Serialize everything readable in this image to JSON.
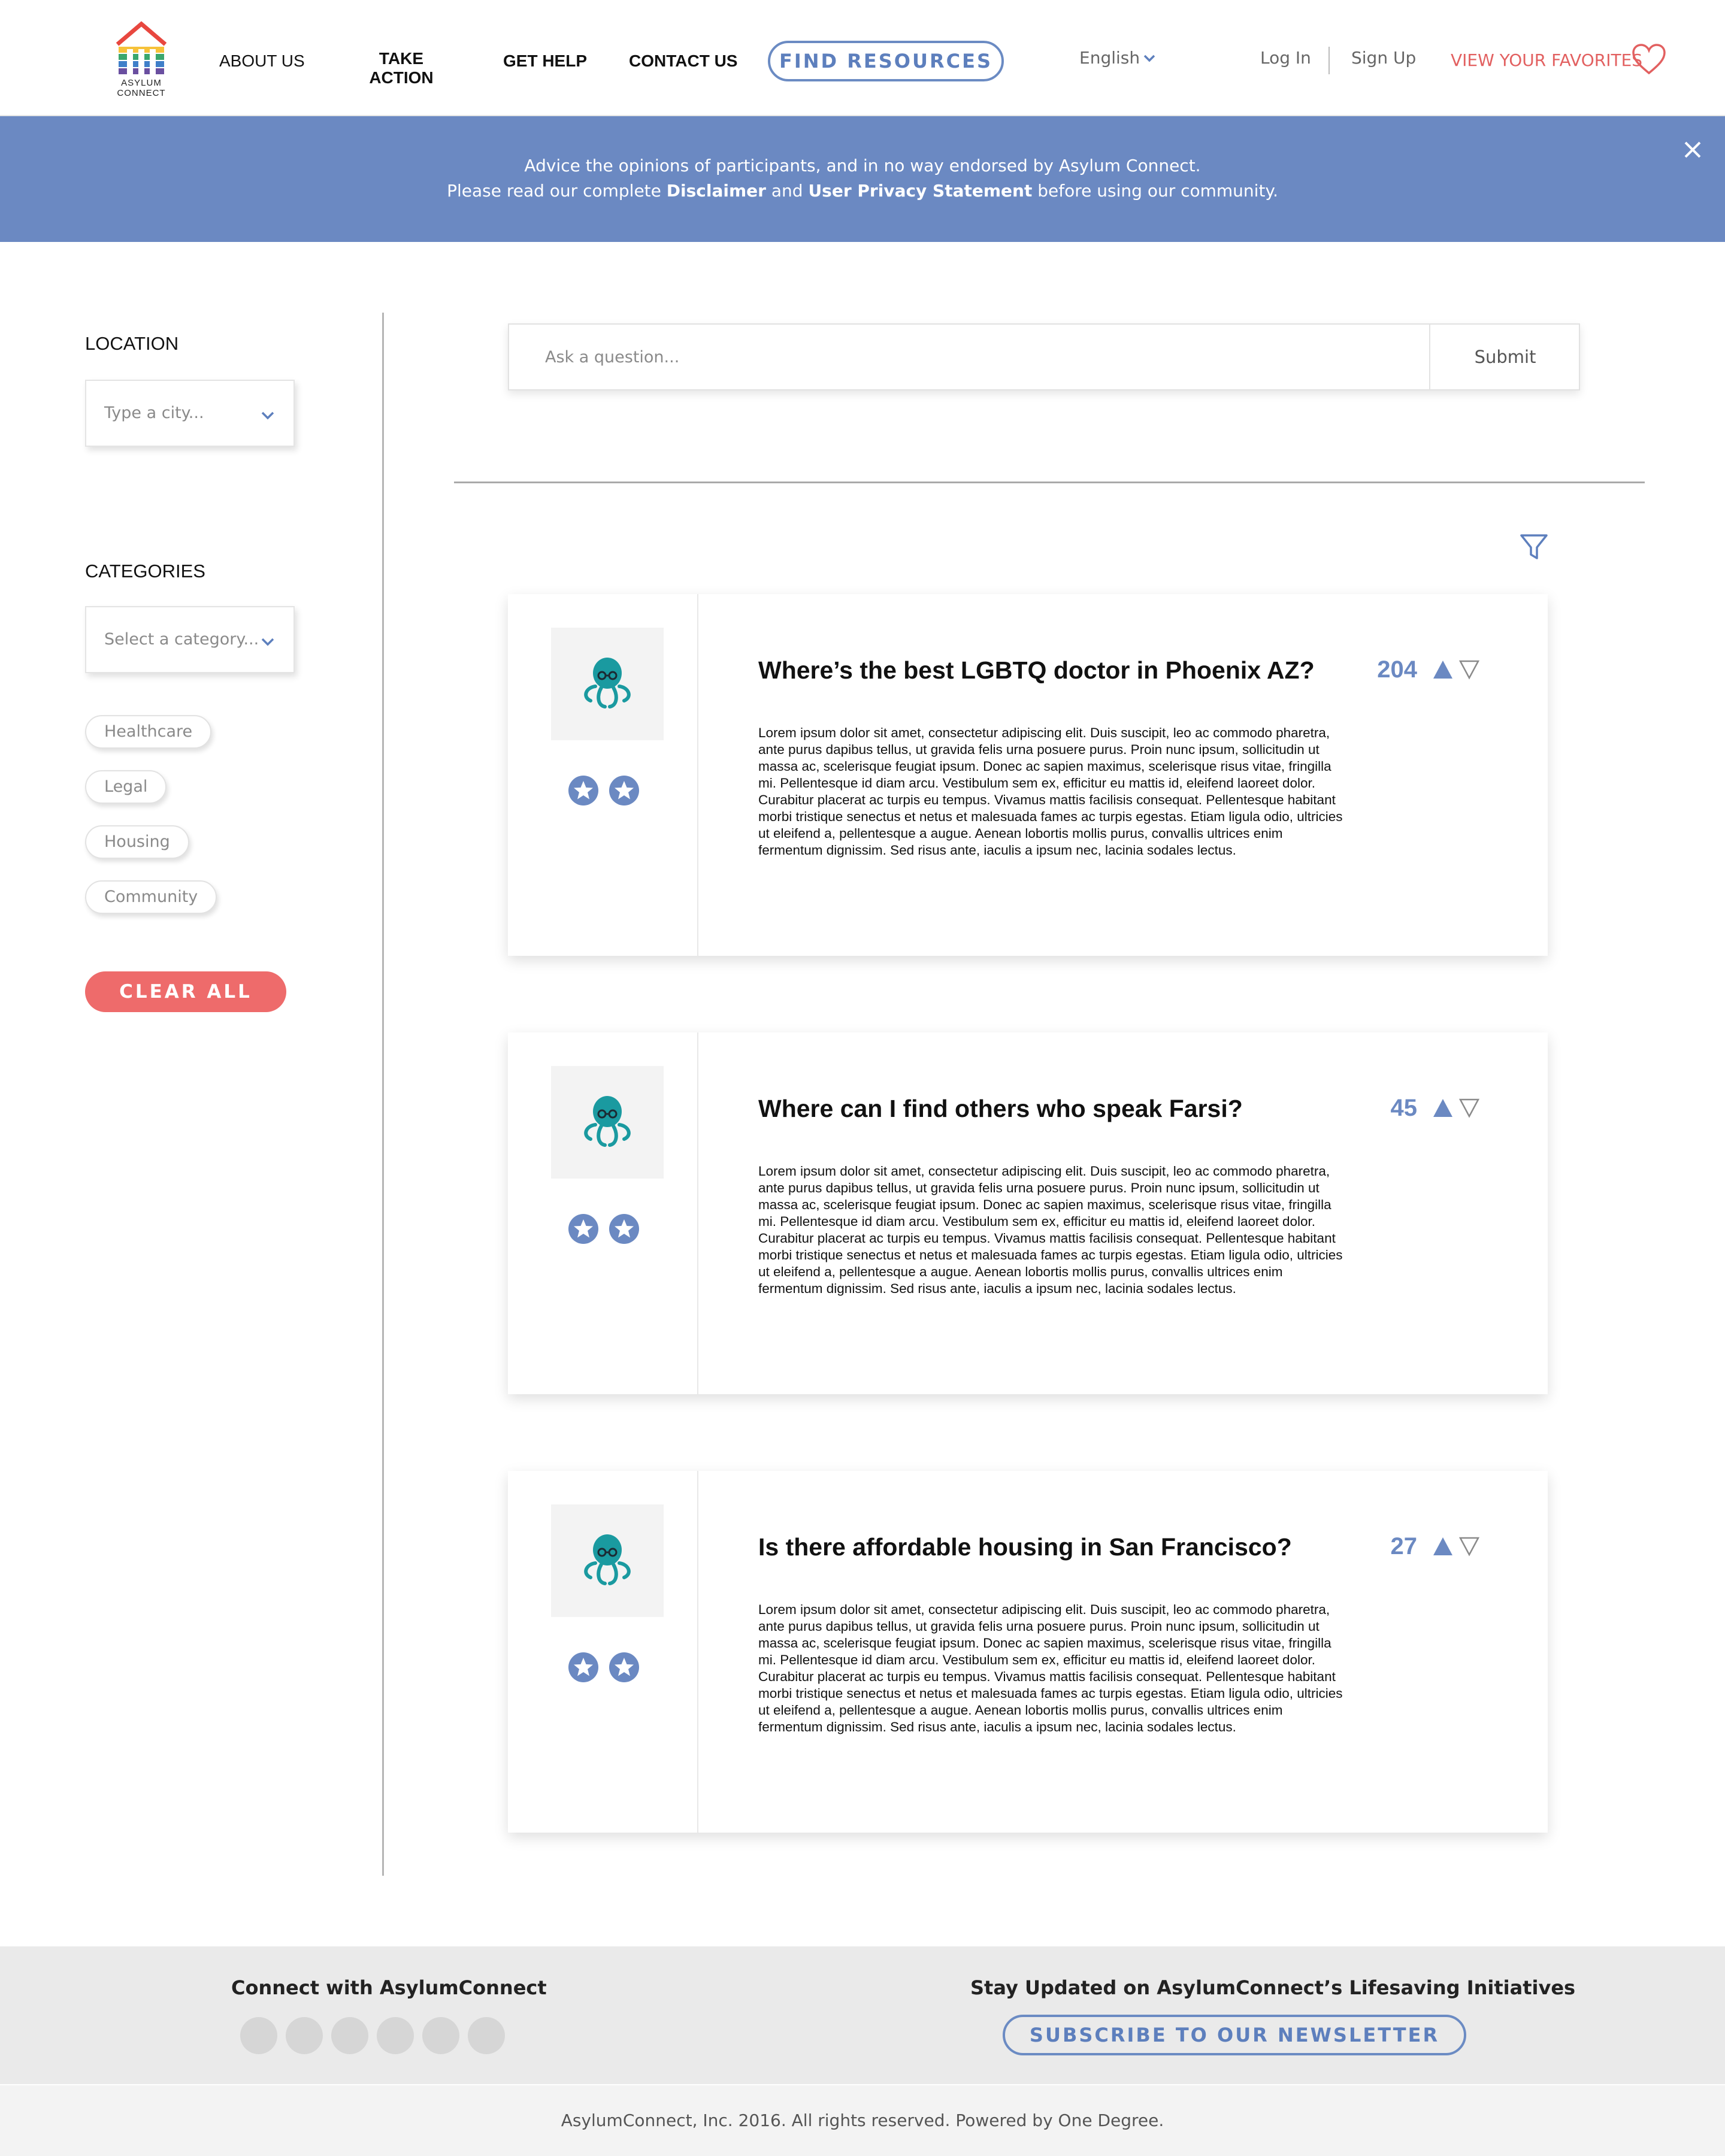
{
  "header": {
    "logo_text_line1": "ASYLUM",
    "logo_text_line2": "CONNECT",
    "nav": {
      "about": "ABOUT US",
      "take_action_line1": "TAKE",
      "take_action_line2": "ACTION",
      "get_help": "GET HELP",
      "contact": "CONTACT US"
    },
    "find_resources": "FIND RESOURCES",
    "language": "English",
    "login": "Log In",
    "signup": "Sign Up",
    "favorites": "VIEW YOUR FAVORITES"
  },
  "banner": {
    "line1": "Advice the opinions of participants, and in no way endorsed by Asylum Connect.",
    "line2_pre": "Please read our complete ",
    "disclaimer": "Disclaimer",
    "and": " and ",
    "privacy": "User Privacy Statement",
    "line2_post": " before using our community."
  },
  "sidebar": {
    "location_label": "LOCATION",
    "location_placeholder": "Type a city...",
    "categories_label": "CATEGORIES",
    "category_placeholder": "Select a category...",
    "chips": [
      "Healthcare",
      "Legal",
      "Housing",
      "Community"
    ],
    "clear_all": "CLEAR ALL"
  },
  "search": {
    "placeholder": "Ask a question...",
    "submit": "Submit"
  },
  "posts": [
    {
      "title": "Where’s the best LGBTQ doctor in Phoenix AZ?",
      "votes": "204",
      "body": "Lorem ipsum dolor sit amet, consectetur adipiscing elit. Duis suscipit, leo ac commodo pharetra, ante purus dapibus tellus, ut gravida felis urna posuere purus. Proin nunc ipsum, sollicitudin ut massa ac, scelerisque feugiat ipsum. Donec ac sapien maximus, scelerisque risus vitae, fringilla mi. Pellentesque id diam arcu. Vestibulum sem ex, efficitur eu mattis id, eleifend laoreet dolor. Curabitur placerat ac turpis eu tempus. Vivamus mattis facilisis consequat. Pellentesque habitant morbi tristique senectus et netus et malesuada fames ac turpis egestas. Etiam ligula odio, ultricies ut eleifend a, pellentesque a augue. Aenean lobortis mollis purus, convallis ultrices enim fermentum dignissim. Sed risus ante, iaculis a ipsum nec, lacinia sodales lectus."
    },
    {
      "title": "Where can I find others who speak Farsi?",
      "votes": "45",
      "body": "Lorem ipsum dolor sit amet, consectetur adipiscing elit. Duis suscipit, leo ac commodo pharetra, ante purus dapibus tellus, ut gravida felis urna posuere purus. Proin nunc ipsum, sollicitudin ut massa ac, scelerisque feugiat ipsum. Donec ac sapien maximus, scelerisque risus vitae, fringilla mi. Pellentesque id diam arcu. Vestibulum sem ex, efficitur eu mattis id, eleifend laoreet dolor. Curabitur placerat ac turpis eu tempus. Vivamus mattis facilisis consequat. Pellentesque habitant morbi tristique senectus et netus et malesuada fames ac turpis egestas. Etiam ligula odio, ultricies ut eleifend a, pellentesque a augue. Aenean lobortis mollis purus, convallis ultrices enim fermentum dignissim. Sed risus ante, iaculis a ipsum nec, lacinia sodales lectus."
    },
    {
      "title": "Is there affordable housing in San Francisco?",
      "votes": "27",
      "body": "Lorem ipsum dolor sit amet, consectetur adipiscing elit. Duis suscipit, leo ac commodo pharetra, ante purus dapibus tellus, ut gravida felis urna posuere purus. Proin nunc ipsum, sollicitudin ut massa ac, scelerisque feugiat ipsum. Donec ac sapien maximus, scelerisque risus vitae, fringilla mi. Pellentesque id diam arcu. Vestibulum sem ex, efficitur eu mattis id, eleifend laoreet dolor. Curabitur placerat ac turpis eu tempus. Vivamus mattis facilisis consequat. Pellentesque habitant morbi tristique senectus et netus et malesuada fames ac turpis egestas. Etiam ligula odio, ultricies ut eleifend a, pellentesque a augue. Aenean lobortis mollis purus, convallis ultrices enim fermentum dignissim. Sed risus ante, iaculis a ipsum nec, lacinia sodales lectus."
    }
  ],
  "footer": {
    "connect_title": "Connect with AsylumConnect",
    "updates_title": "Stay Updated on AsylumConnect’s Lifesaving Initiatives",
    "subscribe": "SUBSCRIBE TO OUR NEWSLETTER",
    "copyright": "AsylumConnect, Inc. 2016. All rights reserved. Powered by One Degree."
  },
  "icons": {
    "logo": "house-rainbow-logo",
    "language_chevron": "chevron-down-icon",
    "favorites": "heart-icon",
    "banner_close": "close-icon",
    "filter": "filter-icon",
    "avatar": "octopus-avatar-icon",
    "badge": "star-badge-icon",
    "upvote": "triangle-up-icon",
    "downvote": "triangle-down-icon"
  },
  "colors": {
    "accent_blue": "#6b89c2",
    "accent_red": "#ee6b6b",
    "avatar_teal": "#1a9aa0"
  }
}
